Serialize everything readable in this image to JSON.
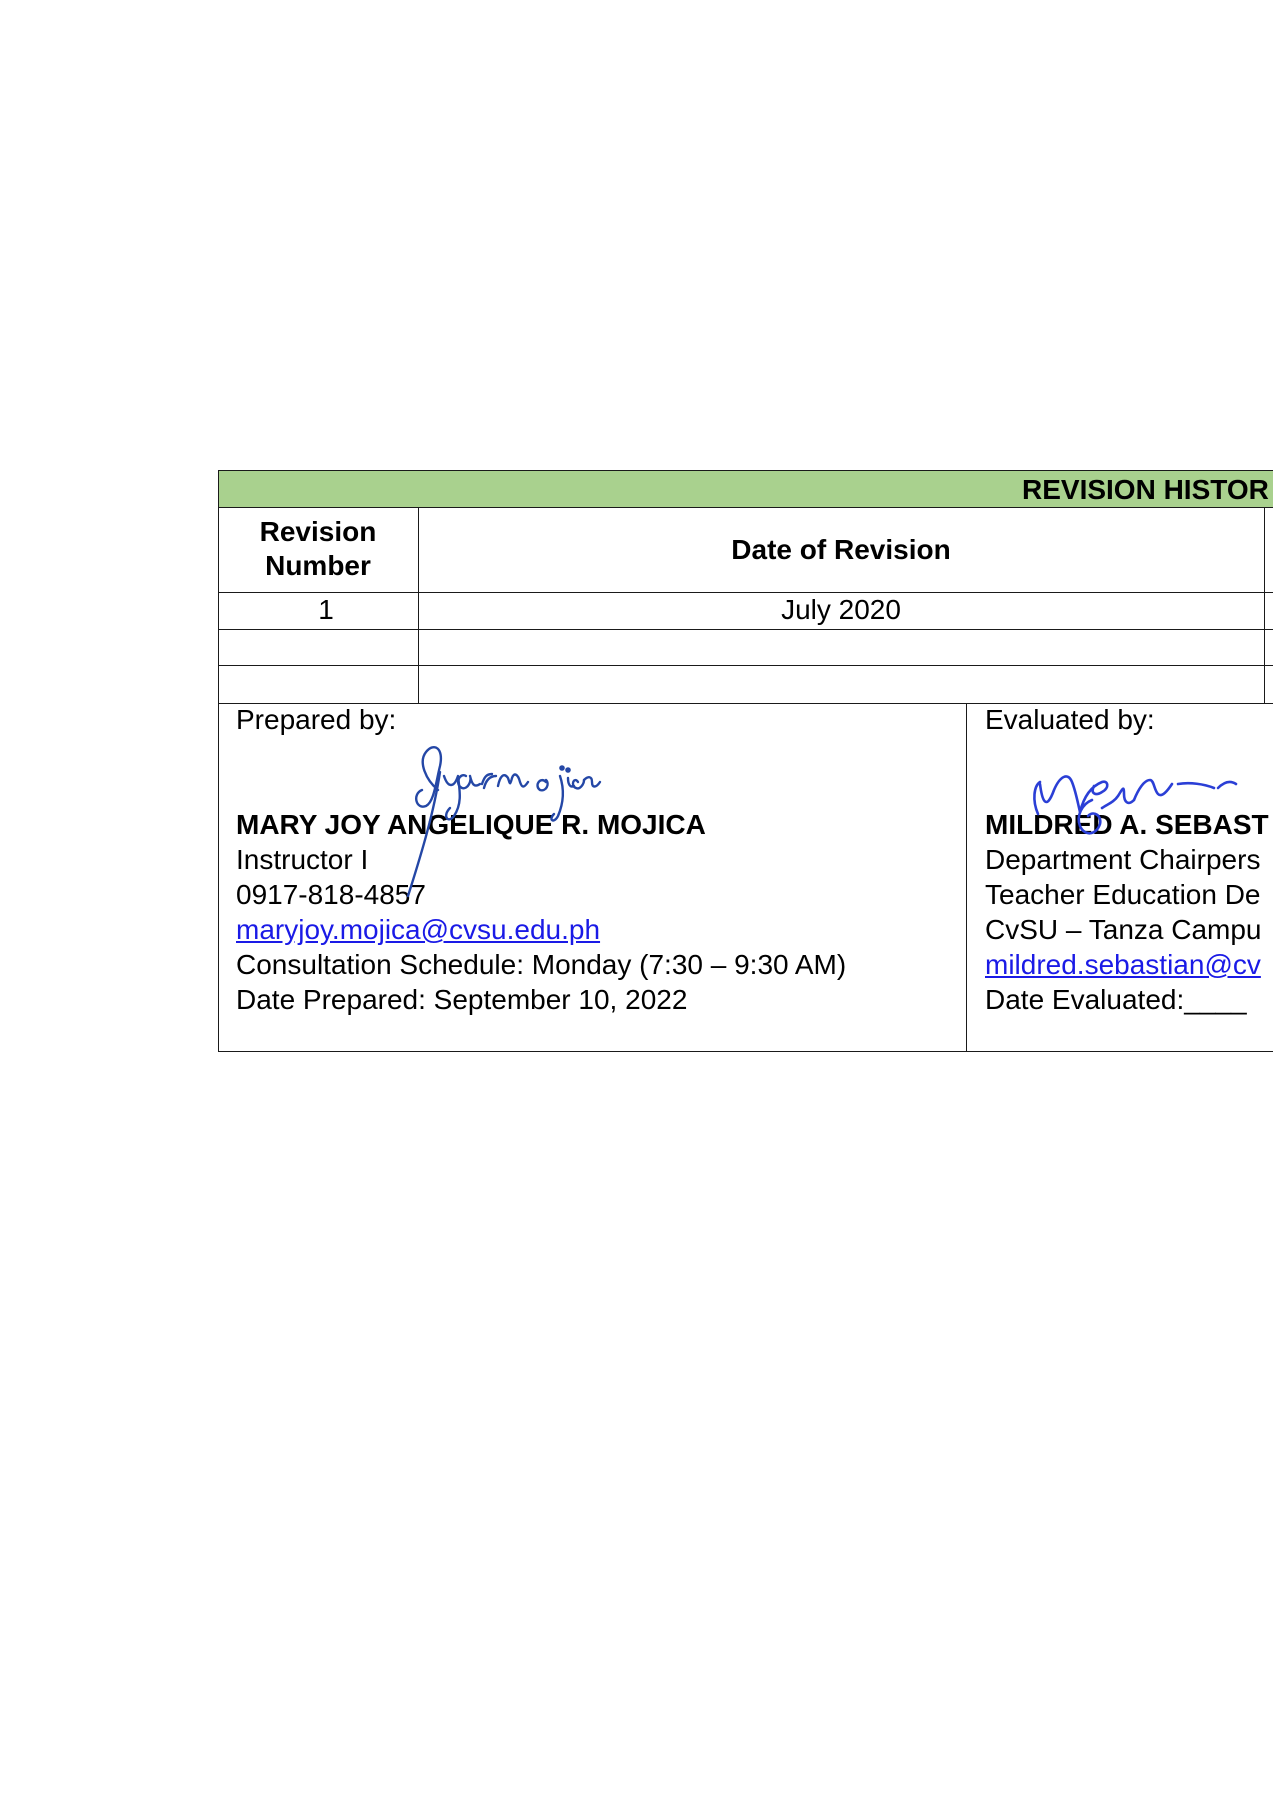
{
  "revision_history": {
    "title": "REVISION HISTOR",
    "columns": [
      "Revision Number",
      "Date of Revision"
    ],
    "rows": [
      [
        "1",
        "July  2020"
      ],
      [
        "",
        ""
      ],
      [
        "",
        ""
      ]
    ]
  },
  "prepared": {
    "label": "Prepared by:",
    "name": "MARY JOY ANGELIQUE R. MOJICA",
    "position": "Instructor I",
    "phone": "0917-818-4857",
    "email": "maryjoy.mojica@cvsu.edu.ph",
    "schedule": "Consultation Schedule: Monday (7:30 – 9:30 AM)",
    "date": "Date Prepared: September 10, 2022",
    "signature": "signature"
  },
  "evaluated": {
    "label": "Evaluated by:",
    "name": "MILDRED A. SEBAST",
    "position": "Department Chairpers",
    "department": "Teacher Education De",
    "campus": "CvSU – Tanza Campu",
    "email": "mildred.sebastian@cv",
    "date": "Date Evaluated:____",
    "signature": "signature"
  }
}
